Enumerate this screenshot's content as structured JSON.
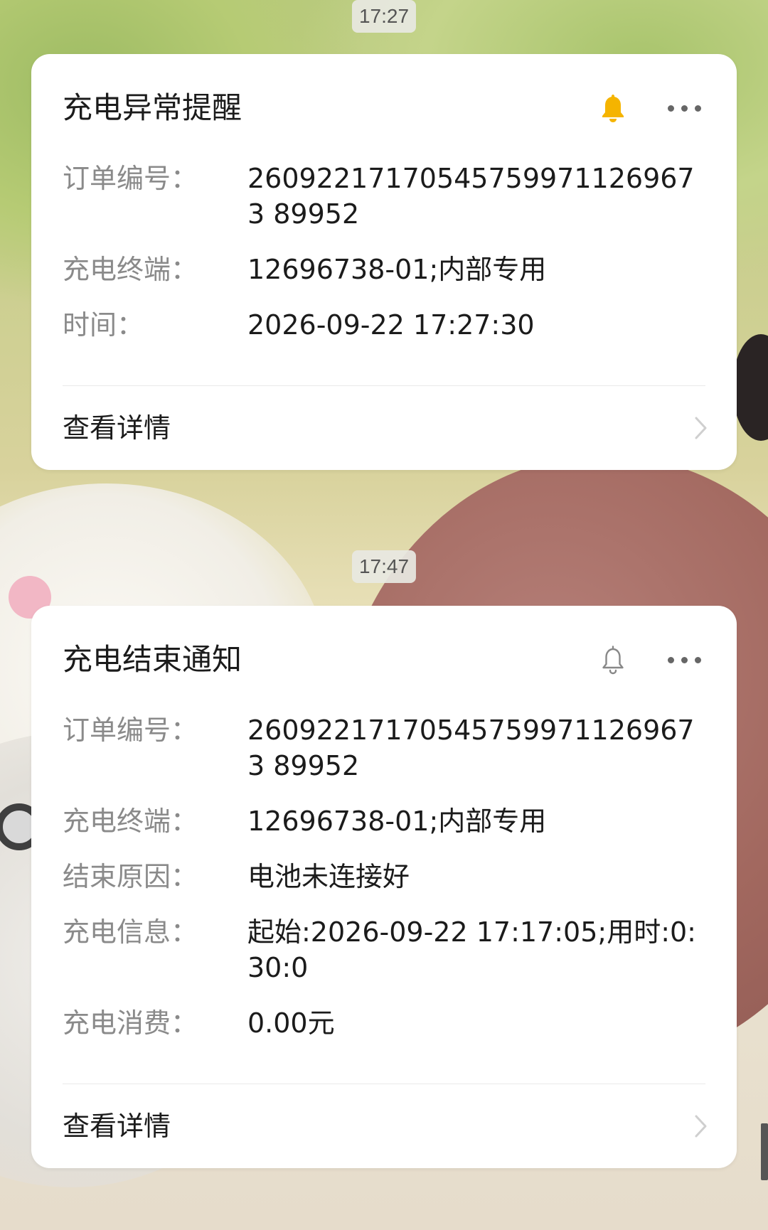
{
  "colors": {
    "card_bg": "#ffffff",
    "label": "#8a8a8a",
    "value": "#1b1b1b",
    "bell_active": "#f5b400",
    "bell_inactive": "#888888"
  },
  "messages": [
    {
      "timestamp": "17:27",
      "title": "充电异常提醒",
      "bell_icon": "bell-filled-icon",
      "fields": [
        {
          "label": "订单编号：",
          "value": "260922171705457599711269673 89952"
        },
        {
          "label": "充电终端：",
          "value": "12696738-01;内部专用"
        },
        {
          "label": "时间：",
          "value": "2026-09-22 17:27:30"
        }
      ],
      "detail_label": "查看详情"
    },
    {
      "timestamp": "17:47",
      "title": "充电结束通知",
      "bell_icon": "bell-outline-icon",
      "fields": [
        {
          "label": "订单编号：",
          "value": "260922171705457599711269673 89952"
        },
        {
          "label": "充电终端：",
          "value": "12696738-01;内部专用"
        },
        {
          "label": "结束原因：",
          "value": "电池未连接好"
        },
        {
          "label": "充电信息：",
          "value": "起始:2026-09-22 17:17:05;用时:0:30:0"
        },
        {
          "label": "充电消费：",
          "value": "0.00元"
        }
      ],
      "detail_label": "查看详情"
    }
  ]
}
